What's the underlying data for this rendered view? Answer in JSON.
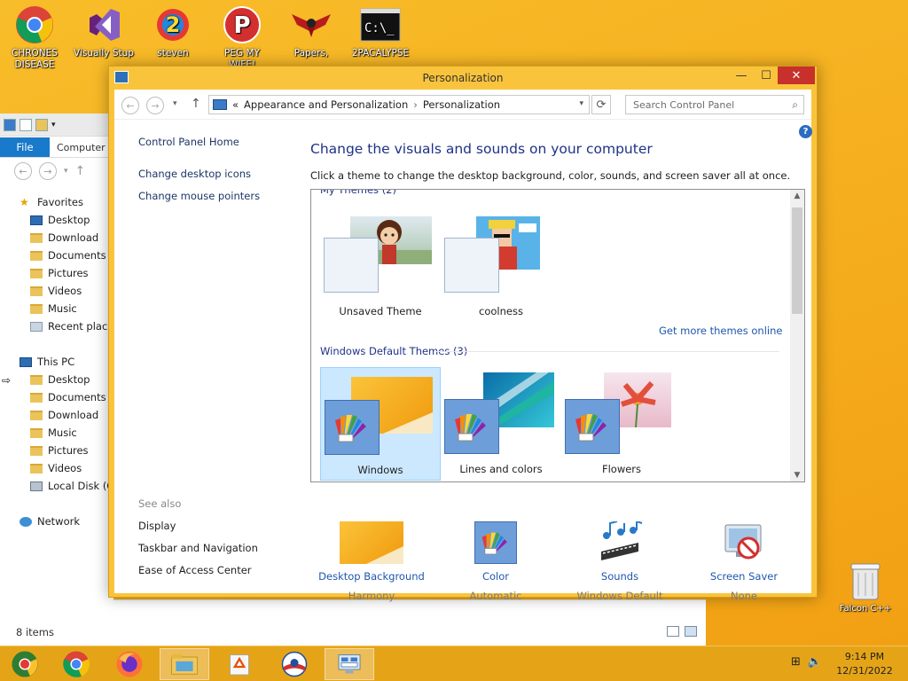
{
  "desktop": {
    "icons": [
      {
        "label": "CHRONES DISEASE",
        "icon": "chrome-icon"
      },
      {
        "label": "Visually Stup",
        "icon": "visual-studio-icon"
      },
      {
        "label": "steven",
        "icon": "steven-icon"
      },
      {
        "label": "PEG MY WIFE!",
        "icon": "peg-icon"
      },
      {
        "label": "Papers,",
        "icon": "papers-icon"
      },
      {
        "label": "2PACALYPSE",
        "icon": "cmd-icon"
      }
    ],
    "recycle_bin_label": "Falcon C++"
  },
  "explorer": {
    "ribbon": {
      "file_tab": "File",
      "computer_tab": "Computer"
    },
    "tree": [
      {
        "label": "Favorites",
        "icon": "star-icon",
        "indent": 0
      },
      {
        "label": "Desktop",
        "icon": "desktop-icon",
        "indent": 1
      },
      {
        "label": "Download",
        "icon": "folder-icon",
        "indent": 1
      },
      {
        "label": "Documents",
        "icon": "folder-icon",
        "indent": 1
      },
      {
        "label": "Pictures",
        "icon": "folder-icon",
        "indent": 1
      },
      {
        "label": "Videos",
        "icon": "folder-icon",
        "indent": 1
      },
      {
        "label": "Music",
        "icon": "folder-icon",
        "indent": 1
      },
      {
        "label": "Recent places",
        "icon": "recent-icon",
        "indent": 1
      },
      {
        "label": "",
        "icon": "",
        "indent": 0
      },
      {
        "label": "This PC",
        "icon": "pc-icon",
        "indent": 0
      },
      {
        "label": "Desktop",
        "icon": "folder-icon",
        "indent": 1
      },
      {
        "label": "Documents",
        "icon": "folder-icon",
        "indent": 1
      },
      {
        "label": "Download",
        "icon": "folder-icon",
        "indent": 1
      },
      {
        "label": "Music",
        "icon": "folder-icon",
        "indent": 1
      },
      {
        "label": "Pictures",
        "icon": "folder-icon",
        "indent": 1
      },
      {
        "label": "Videos",
        "icon": "folder-icon",
        "indent": 1
      },
      {
        "label": "Local Disk (C:)",
        "icon": "disk-icon",
        "indent": 1
      },
      {
        "label": "",
        "icon": "",
        "indent": 0
      },
      {
        "label": "Network",
        "icon": "network-icon",
        "indent": 0
      }
    ],
    "status": "8 items"
  },
  "window": {
    "title": "Personalization",
    "address": {
      "prefix": "«",
      "crumbs": [
        "Appearance and Personalization",
        "Personalization"
      ]
    },
    "search_placeholder": "Search Control Panel",
    "left_nav": {
      "home": "Control Panel Home",
      "links": [
        "Change desktop icons",
        "Change mouse pointers"
      ],
      "see_also_label": "See also",
      "see_also": [
        "Display",
        "Taskbar and Navigation",
        "Ease of Access Center"
      ]
    },
    "heading": "Change the visuals and sounds on your computer",
    "subtitle": "Click a theme to change the desktop background, color, sounds, and screen saver all at once.",
    "my_themes_header": "My Themes (2)",
    "my_themes": [
      "Unsaved Theme",
      "coolness"
    ],
    "get_more_link": "Get more themes online",
    "default_themes_header": "Windows Default Themes (3)",
    "default_themes": [
      "Windows",
      "Lines and colors",
      "Flowers"
    ],
    "selected_theme": "Windows",
    "bottom": [
      {
        "label": "Desktop Background",
        "value": "Harmony",
        "icon": "desktop-background-icon"
      },
      {
        "label": "Color",
        "value": "Automatic",
        "icon": "color-icon"
      },
      {
        "label": "Sounds",
        "value": "Windows Default",
        "icon": "sounds-icon"
      },
      {
        "label": "Screen Saver",
        "value": "None",
        "icon": "screen-saver-icon"
      }
    ]
  },
  "taskbar": {
    "buttons": [
      "chrome-canary",
      "chrome",
      "firefox",
      "file-explorer",
      "recycle-app",
      "obama-app",
      "control-panel"
    ],
    "active": "control-panel",
    "time": "9:14 PM",
    "date": "12/31/2022"
  },
  "colors": {
    "desktop": "#f5ad1d",
    "window_frame": "#f9c43c",
    "close_button": "#c7302b",
    "link": "#1e56b0",
    "heading": "#1e3287",
    "selection": "#cce8ff"
  }
}
